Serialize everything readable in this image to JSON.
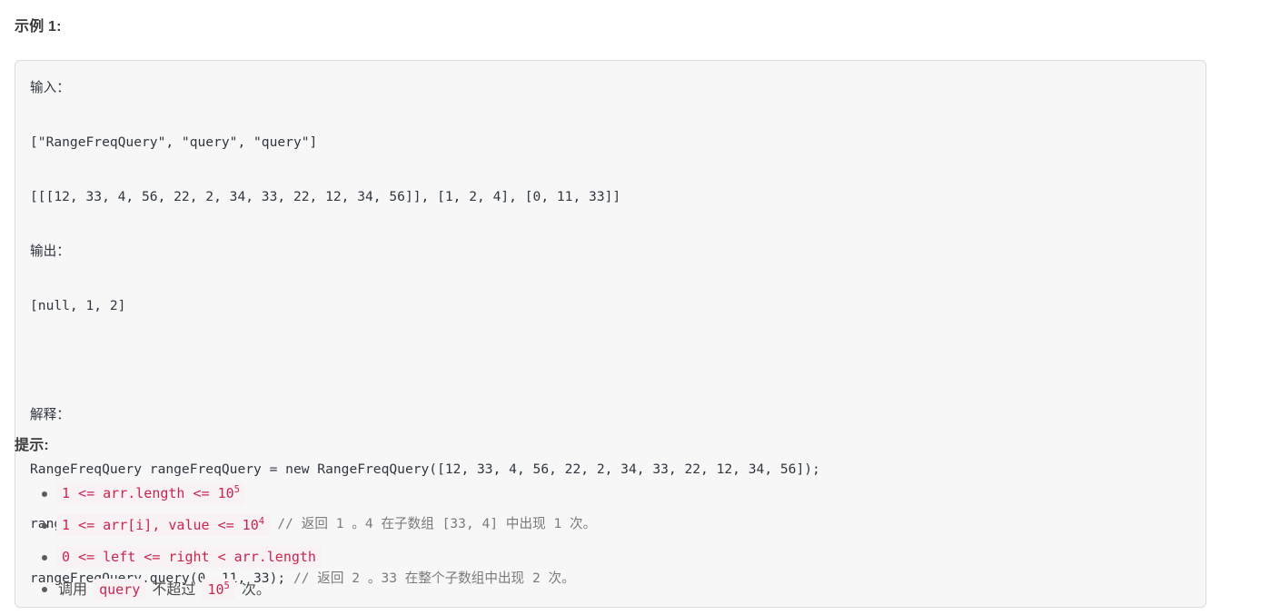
{
  "example": {
    "heading": "示例 1:",
    "code_lines": [
      {
        "text": "输入：",
        "comment": ""
      },
      {
        "text": "[\"RangeFreqQuery\", \"query\", \"query\"]",
        "comment": ""
      },
      {
        "text": "[[[12, 33, 4, 56, 22, 2, 34, 33, 22, 12, 34, 56]], [1, 2, 4], [0, 11, 33]]",
        "comment": ""
      },
      {
        "text": "输出：",
        "comment": ""
      },
      {
        "text": "[null, 1, 2]",
        "comment": ""
      },
      {
        "text": "",
        "comment": ""
      },
      {
        "text": "解释：",
        "comment": ""
      },
      {
        "text": "RangeFreqQuery rangeFreqQuery = new RangeFreqQuery([12, 33, 4, 56, 22, 2, 34, 33, 22, 12, 34, 56]);",
        "comment": ""
      },
      {
        "text": "rangeFreqQuery.query(1, 2, 4); ",
        "comment": "// 返回 1 。4 在子数组 [33, 4] 中出现 1 次。"
      },
      {
        "text": "rangeFreqQuery.query(0, 11, 33); ",
        "comment": "// 返回 2 。33 在整个子数组中出现 2 次。"
      }
    ]
  },
  "hints": {
    "heading": "提示:",
    "items": [
      {
        "parts": [
          {
            "kind": "code",
            "text": "1 <= arr.length <= 10",
            "sup": "5"
          }
        ]
      },
      {
        "parts": [
          {
            "kind": "code",
            "text": "1 <= arr[i], value <= 10",
            "sup": "4"
          }
        ]
      },
      {
        "parts": [
          {
            "kind": "code",
            "text": "0 <= left <= right < arr.length",
            "sup": ""
          }
        ]
      },
      {
        "parts": [
          {
            "kind": "text",
            "text": "调用 "
          },
          {
            "kind": "code",
            "text": "query",
            "sup": ""
          },
          {
            "kind": "text",
            "text": " 不超过 "
          },
          {
            "kind": "code",
            "text": "10",
            "sup": "5"
          },
          {
            "kind": "text",
            "text": " 次。"
          }
        ]
      }
    ]
  },
  "colors": {
    "code_block_bg": "#f7f7f7",
    "code_block_border": "#dcdcdc",
    "inline_code_text": "#c7254e",
    "inline_code_bg": "#f9f2f4",
    "body_text": "#3b3b3b",
    "comment_text": "#7a7a7a"
  }
}
